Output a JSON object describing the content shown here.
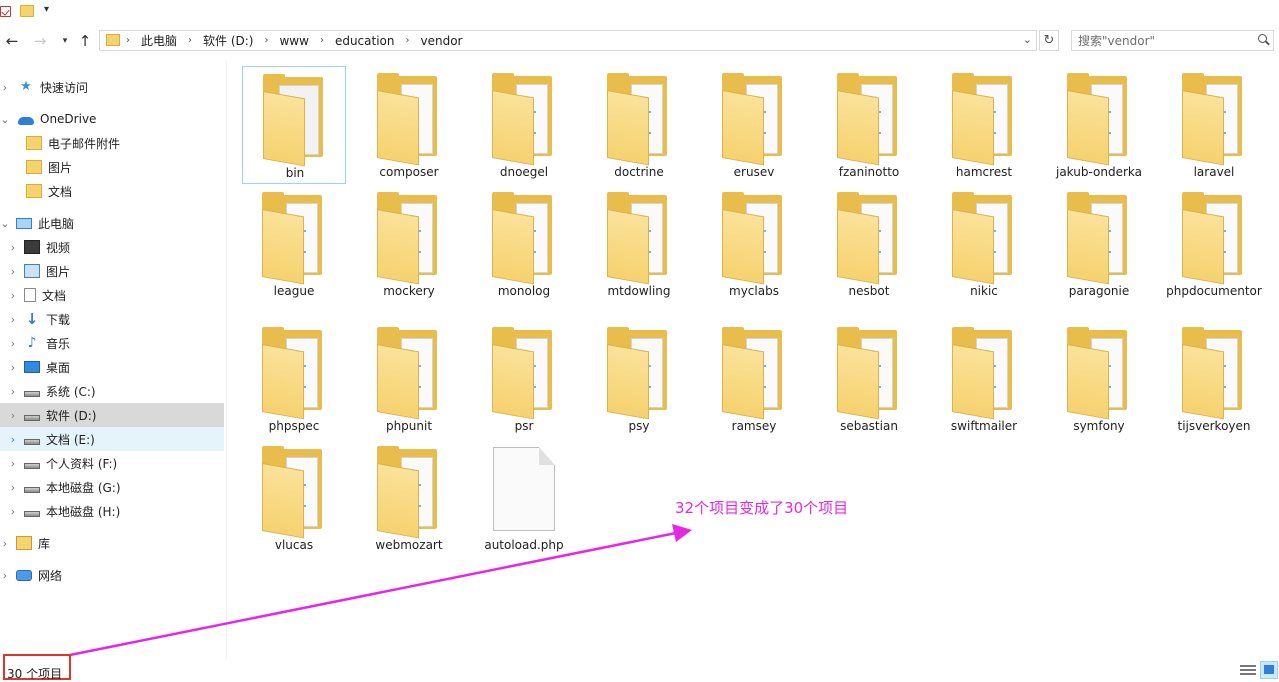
{
  "address": {
    "crumbs": [
      "此电脑",
      "软件 (D:)",
      "www",
      "education",
      "vendor"
    ]
  },
  "search": {
    "placeholder": "搜索\"vendor\""
  },
  "nav": {
    "items": [
      {
        "label": "快速访问",
        "icon": "star-icon"
      },
      {
        "label": "OneDrive",
        "icon": "cloud-icon"
      },
      {
        "label": "电子邮件附件",
        "icon": "folder-icon"
      },
      {
        "label": "图片",
        "icon": "folder-icon"
      },
      {
        "label": "文档",
        "icon": "folder-icon"
      },
      {
        "label": "此电脑",
        "icon": "computer-icon"
      },
      {
        "label": "视频",
        "icon": "video-icon"
      },
      {
        "label": "图片",
        "icon": "pictures-icon"
      },
      {
        "label": "文档",
        "icon": "documents-icon"
      },
      {
        "label": "下载",
        "icon": "download-icon"
      },
      {
        "label": "音乐",
        "icon": "music-icon"
      },
      {
        "label": "桌面",
        "icon": "desktop-icon"
      },
      {
        "label": "系统 (C:)",
        "icon": "drive-icon"
      },
      {
        "label": "软件 (D:)",
        "icon": "drive-icon"
      },
      {
        "label": "文档 (E:)",
        "icon": "drive-icon"
      },
      {
        "label": "个人资料 (F:)",
        "icon": "drive-icon"
      },
      {
        "label": "本地磁盘 (G:)",
        "icon": "drive-icon"
      },
      {
        "label": "本地磁盘 (H:)",
        "icon": "drive-icon"
      },
      {
        "label": "库",
        "icon": "library-icon"
      },
      {
        "label": "网络",
        "icon": "network-icon"
      }
    ]
  },
  "files": [
    {
      "name": "bin",
      "kind": "folder-gear"
    },
    {
      "name": "composer",
      "kind": "folder-plain"
    },
    {
      "name": "dnoegel",
      "kind": "folder"
    },
    {
      "name": "doctrine",
      "kind": "folder"
    },
    {
      "name": "erusev",
      "kind": "folder"
    },
    {
      "name": "fzaninotto",
      "kind": "folder"
    },
    {
      "name": "hamcrest",
      "kind": "folder"
    },
    {
      "name": "jakub-onderka",
      "kind": "folder"
    },
    {
      "name": "laravel",
      "kind": "folder"
    },
    {
      "name": "league",
      "kind": "folder"
    },
    {
      "name": "mockery",
      "kind": "folder"
    },
    {
      "name": "monolog",
      "kind": "folder"
    },
    {
      "name": "mtdowling",
      "kind": "folder"
    },
    {
      "name": "myclabs",
      "kind": "folder"
    },
    {
      "name": "nesbot",
      "kind": "folder"
    },
    {
      "name": "nikic",
      "kind": "folder"
    },
    {
      "name": "paragonie",
      "kind": "folder"
    },
    {
      "name": "phpdocumentor",
      "kind": "folder"
    },
    {
      "name": "phpspec",
      "kind": "folder"
    },
    {
      "name": "phpunit",
      "kind": "folder"
    },
    {
      "name": "psr",
      "kind": "folder"
    },
    {
      "name": "psy",
      "kind": "folder"
    },
    {
      "name": "ramsey",
      "kind": "folder"
    },
    {
      "name": "sebastian",
      "kind": "folder"
    },
    {
      "name": "swiftmailer",
      "kind": "folder"
    },
    {
      "name": "symfony",
      "kind": "folder"
    },
    {
      "name": "tijsverkoyen",
      "kind": "folder"
    },
    {
      "name": "vlucas",
      "kind": "folder"
    },
    {
      "name": "webmozart",
      "kind": "folder"
    },
    {
      "name": "autoload.php",
      "kind": "file"
    }
  ],
  "annotation": {
    "text": "32个项目变成了30个项目",
    "color": "#e528e5"
  },
  "status": {
    "count": "30 个项目"
  }
}
